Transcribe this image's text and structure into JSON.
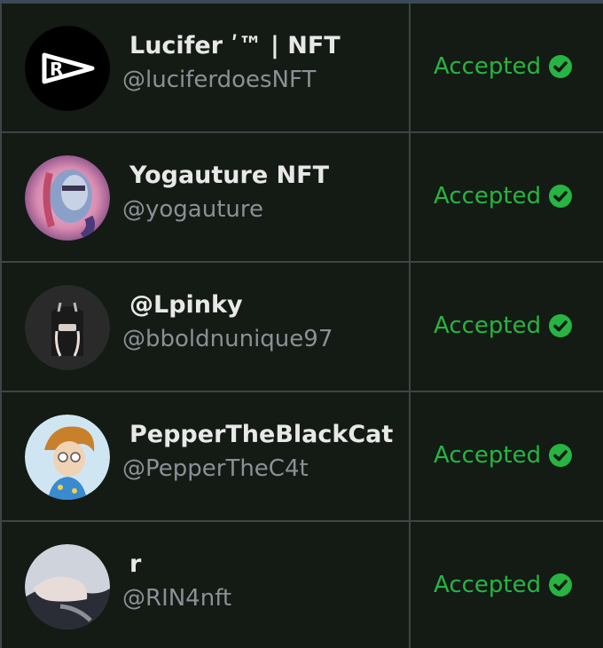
{
  "rows": [
    {
      "name": "Lucifer ʹ™ | NFT",
      "handle": "@luciferdoesNFT",
      "status": "Accepted",
      "avatar": "brand-logo-avatar"
    },
    {
      "name": "Yogauture NFT",
      "handle": "@yogauture",
      "status": "Accepted",
      "avatar": "portrait-avatar"
    },
    {
      "name": "@Lpinky",
      "handle": "@bboldnunique97",
      "status": "Accepted",
      "avatar": "character-avatar"
    },
    {
      "name": "PepperTheBlackCat",
      "handle": "@PepperTheC4t",
      "status": "Accepted",
      "avatar": "cartoon-avatar"
    },
    {
      "name": "r",
      "handle": "@RIN4nft",
      "status": "Accepted",
      "avatar": "photo-avatar"
    }
  ],
  "colors": {
    "background": "#131b14",
    "accepted": "#27b442",
    "name": "#e8e8e8",
    "handle": "#8a9096",
    "grid": "#3e4549"
  },
  "icons": {
    "status": "check-circle-icon"
  }
}
